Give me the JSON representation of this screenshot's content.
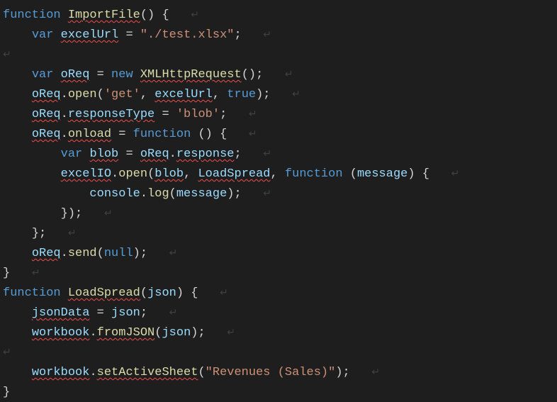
{
  "code": {
    "l1": {
      "kw1": "function",
      "fn": "ImportFile",
      "rest": "() {",
      "ws": "↵"
    },
    "l2": {
      "indent": "    ",
      "kw": "var",
      "sp": " ",
      "id": "excelUrl",
      "rest": " = ",
      "str": "\"./test.xlsx\"",
      "semi": ";",
      "ws": "↵"
    },
    "l3": {
      "ws": "↵"
    },
    "l4": {
      "indent": "    ",
      "kw1": "var",
      "sp1": " ",
      "id1": "oReq",
      "eq": " = ",
      "kw2": "new",
      "sp2": " ",
      "fn": "XMLHttpRequest",
      "rest": "();",
      "ws": "↵"
    },
    "l5": {
      "indent": "    ",
      "id": "oReq",
      "dot": ".",
      "fn": "open",
      "paren": "(",
      "str1": "'get'",
      "c1": ", ",
      "id2": "excelUrl",
      "c2": ", ",
      "kw": "true",
      "rest": ");",
      "ws": "↵"
    },
    "l6": {
      "indent": "    ",
      "id": "oReq",
      "dot": ".",
      "prop": "responseType",
      "eq": " = ",
      "str": "'blob'",
      "semi": ";",
      "ws": "↵"
    },
    "l7": {
      "indent": "    ",
      "id": "oReq",
      "dot": ".",
      "prop": "onload",
      "eq": " = ",
      "kw": "function",
      "rest": " () {",
      "ws": "↵"
    },
    "l8": {
      "indent": "        ",
      "kw": "var",
      "sp": " ",
      "id1": "blob",
      "eq": " = ",
      "id2": "oReq",
      "dot": ".",
      "prop": "response",
      "semi": ";",
      "ws": "↵"
    },
    "l9": {
      "indent": "        ",
      "id": "excelIO",
      "dot": ".",
      "fn": "open",
      "paren": "(",
      "id1": "blob",
      "c1": ", ",
      "id2": "LoadSpread",
      "c2": ", ",
      "kw": "function",
      "rest": " (",
      "id3": "message",
      "rest2": ") {",
      "ws": "↵"
    },
    "l10": {
      "indent": "            ",
      "id": "console",
      "dot": ".",
      "fn": "log",
      "paren": "(",
      "id2": "message",
      "rest": ");",
      "ws": "↵"
    },
    "l11": {
      "indent": "        ",
      "rest": "});",
      "ws": "↵"
    },
    "l12": {
      "indent": "    ",
      "rest": "};",
      "ws": "↵"
    },
    "l13": {
      "indent": "    ",
      "id": "oReq",
      "dot": ".",
      "fn": "send",
      "paren": "(",
      "kw": "null",
      "rest": ");",
      "ws": "↵"
    },
    "l14": {
      "rest": "}",
      "ws": "↵"
    },
    "l15": {
      "kw": "function",
      "sp": " ",
      "fn": "LoadSpread",
      "paren": "(",
      "id": "json",
      "rest": ") {",
      "ws": "↵"
    },
    "l16": {
      "indent": "    ",
      "id1": "jsonData",
      "eq": " = ",
      "id2": "json",
      "semi": ";",
      "ws": "↵"
    },
    "l17": {
      "indent": "    ",
      "id": "workbook",
      "dot": ".",
      "fn": "fromJSON",
      "paren": "(",
      "id2": "json",
      "rest": ");",
      "ws": "↵"
    },
    "l18": {
      "ws": "↵"
    },
    "l19": {
      "indent": "    ",
      "id": "workbook",
      "dot": ".",
      "fn": "setActiveSheet",
      "paren": "(",
      "str": "\"Revenues (Sales)\"",
      "rest": ");",
      "ws": "↵"
    },
    "l20": {
      "rest": "}"
    }
  }
}
